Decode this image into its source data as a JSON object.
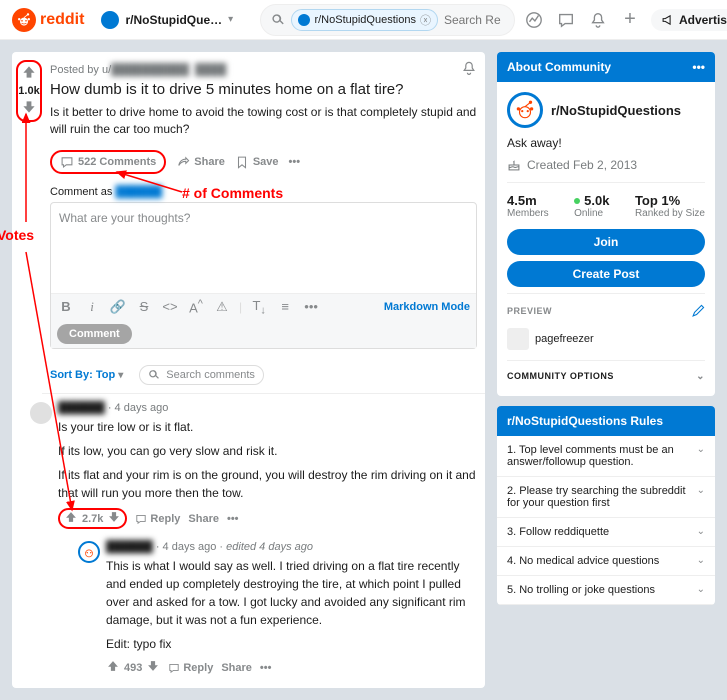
{
  "header": {
    "logo_text": "reddit",
    "subreddit": "r/NoStupidQue…",
    "search_pill": "r/NoStupidQuestions",
    "search_placeholder": "Search Re",
    "advertise": "Advertise"
  },
  "post": {
    "posted_by_prefix": "Posted by u/",
    "author": "██████████",
    "time": "████",
    "score": "1.0k",
    "title": "How dumb is it to drive 5 minutes home on a flat tire?",
    "body": "Is it better to drive home to avoid the towing cost or is that completely stupid and will ruin the car too much?",
    "comments_label": "522 Comments",
    "share": "Share",
    "save": "Save"
  },
  "editor": {
    "comment_as": "Comment as",
    "comment_as_user": "██████",
    "placeholder": "What are your thoughts?",
    "markdown": "Markdown Mode",
    "submit": "Comment"
  },
  "sort": {
    "label": "Sort By: Top",
    "search_placeholder": "Search comments"
  },
  "comments": [
    {
      "user": "██████",
      "time": "4 days ago",
      "edited": "",
      "paragraphs": [
        "Is your tire low or is it flat.",
        "If its low, you can go very slow and risk it.",
        "If its flat and your rim is on the ground, you will destroy the rim driving on it and that will run you more then the tow."
      ],
      "score": "2.7k"
    },
    {
      "user": "██████",
      "time": "4 days ago",
      "edited": "edited 4 days ago",
      "paragraphs": [
        "This is what I would say as well. I tried driving on a flat tire recently and ended up completely destroying the tire, at which point I pulled over and asked for a tow. I got lucky and avoided any significant rim damage, but it was not a fun experience.",
        "Edit: typo fix"
      ],
      "score": "493"
    }
  ],
  "about": {
    "header": "About Community",
    "name": "r/NoStupidQuestions",
    "desc": "Ask away!",
    "created": "Created Feb 2, 2013",
    "members": "4.5m",
    "members_lbl": "Members",
    "online": "5.0k",
    "online_lbl": "Online",
    "rank": "Top 1%",
    "rank_lbl": "Ranked by Size",
    "join": "Join",
    "create_post": "Create Post",
    "preview_hdr": "PREVIEW",
    "preview_user": "pagefreezer",
    "comm_opts": "COMMUNITY OPTIONS"
  },
  "rules": {
    "header": "r/NoStupidQuestions Rules",
    "items": [
      "1. Top level comments must be an answer/followup question.",
      "2. Please try searching the subreddit for your question first",
      "3. Follow reddiquette",
      "4. No medical advice questions",
      "5. No trolling or joke questions"
    ]
  },
  "annotations": {
    "votes": "Votes",
    "comments": "# of Comments"
  },
  "reply": "Reply",
  "share_c": "Share"
}
